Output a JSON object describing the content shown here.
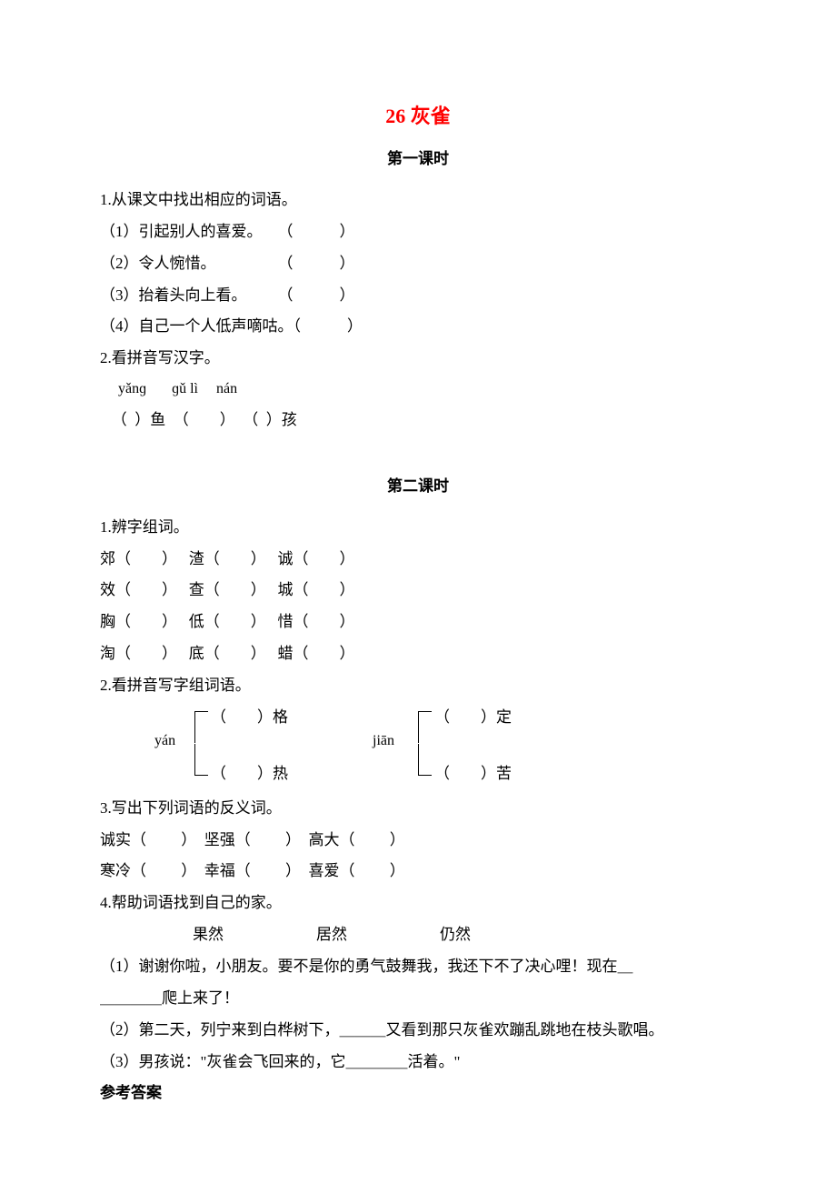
{
  "title": "26 灰雀",
  "section1": {
    "heading": "第一课时",
    "q1": {
      "intro": "1.从课文中找出相应的词语。",
      "items": [
        "（1）引起别人的喜爱。　　（　　　）",
        "（2）令人惋惜。　　　　　（　　　）",
        "（3）抬着头向上看。　　　（　　　）",
        "（4）自己一个人低声嘀咕。（　　　）"
      ]
    },
    "q2": {
      "intro": "2.看拼音写汉字。",
      "pinyin": "     yǎnɡ       ɡǔ lì     nán",
      "chars": "   （  ）鱼  （　　）  （  ）孩"
    }
  },
  "section2": {
    "heading": "第二课时",
    "q1": {
      "intro": "1.辨字组词。",
      "rows": [
        "郊（　　）　 渣（　　）　 诚（　　）",
        "效（　　）　 查（　　）　 城（　　）",
        "胸（　　）　 低（　　）　 惜（　　）",
        "淘（　　）　 底（　　）　 蜡（　　）"
      ]
    },
    "q2": {
      "intro": "2.看拼音写字组词语。",
      "left": {
        "pinyin": "yán",
        "top": "（　　）格",
        "bottom": "（　　）热"
      },
      "right": {
        "pinyin": "jiān",
        "top": "（　　）定",
        "bottom": "（　　）苦"
      }
    },
    "q3": {
      "intro": "3.写出下列词语的反义词。",
      "rows": [
        "诚实（　　 ）　坚强（　　 ）　高大（　　 ）",
        "寒冷（　　 ）　幸福（　　 ）　喜爱（　　 ）"
      ]
    },
    "q4": {
      "intro": "4.帮助词语找到自己的家。",
      "options": "　　　　　　果然　　　　　　居然　　　　　　仍然",
      "items": [
        "（1）谢谢你啦，小朋友。要不是你的勇气鼓舞我，我还下不了决心哩！现在＿",
        "＿＿＿＿爬上来了！",
        "（2）第二天，列宁来到白桦树下，＿＿＿又看到那只灰雀欢蹦乱跳地在枝头歌唱。",
        "（3）男孩说：\"灰雀会飞回来的，它＿＿＿＿活着。\""
      ]
    }
  },
  "answers_heading": "参考答案"
}
